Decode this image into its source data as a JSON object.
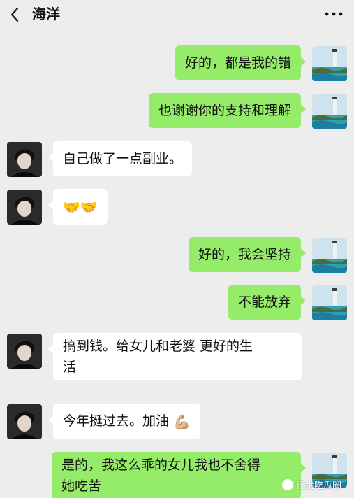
{
  "header": {
    "title": "海洋",
    "back_icon": "chevron-left-icon",
    "more_icon": "ellipsis-icon"
  },
  "messages": [
    {
      "from": "me",
      "text": "好的，都是我的错"
    },
    {
      "from": "me",
      "text": "也谢谢你的支持和理解"
    },
    {
      "from": "other",
      "text": "自己做了一点副业。"
    },
    {
      "from": "other",
      "text": "🤝🤝"
    },
    {
      "from": "me",
      "text": "好的，我会坚持"
    },
    {
      "from": "me",
      "text": "不能放弃"
    },
    {
      "from": "other",
      "text_line1": "搞到钱。给女儿和老婆 更好的生",
      "text_line2": "活"
    },
    {
      "from": "other",
      "text": "今年挺过去。加油",
      "emoji": "💪🏼"
    },
    {
      "from": "me",
      "text_line1": "是的，我这么乖的女儿我也不舍得",
      "text_line2": "她吃苦"
    }
  ],
  "watermark": {
    "text": "行走吃瓜圈"
  },
  "colors": {
    "background": "#ededed",
    "my_bubble": "#95ec69",
    "other_bubble": "#ffffff"
  }
}
